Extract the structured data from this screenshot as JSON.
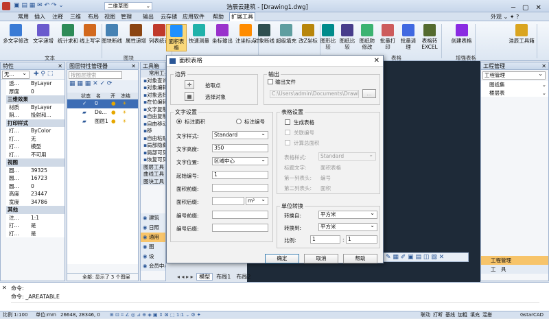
{
  "app": {
    "title": "浩辰云建筑 - [Drawing1.dwg]",
    "workspace": "二维草图",
    "appearance": "外观",
    "accent": "#2b5797"
  },
  "menu": [
    "常用",
    "插入",
    "注释",
    "三维",
    "布局",
    "视图",
    "管理",
    "输出",
    "云存储",
    "应用软件",
    "帮助",
    "扩展工具"
  ],
  "active_menu": "扩展工具",
  "ribbon": {
    "groups": [
      {
        "label": "文本",
        "buttons": [
          "多文字修改",
          "文字递增",
          "统计求和",
          "线上写字"
        ]
      },
      {
        "label": "图块",
        "buttons": [
          "图块断线",
          "属性递增",
          "列表统计"
        ]
      },
      {
        "label": "",
        "buttons": [
          "面积表格",
          "快速测量",
          "坐标输出",
          "注坐标点"
        ]
      },
      {
        "label": "",
        "buttons": [
          "对象断线",
          "超级填充",
          "改Z坐标"
        ]
      },
      {
        "label": "表格",
        "buttons": [
          "图形比较",
          "图纸比较",
          "图纸防修改",
          "批量打印",
          "批量清理",
          "表格转EXCEL"
        ]
      },
      {
        "label": "增强表格",
        "buttons": [
          "创建表格"
        ]
      },
      {
        "label": "",
        "buttons": [
          "浩辰工具箱"
        ]
      }
    ]
  },
  "properties": {
    "title": "特性",
    "selector": "无...",
    "rows": [
      {
        "type": "row",
        "k": "透...",
        "v": "ByLayer"
      },
      {
        "type": "row",
        "k": "厚度",
        "v": "0"
      },
      {
        "type": "cat",
        "k": "三维效果"
      },
      {
        "type": "row",
        "k": "材质",
        "v": "ByLayer"
      },
      {
        "type": "row",
        "k": "阴...",
        "v": "投射和..."
      },
      {
        "type": "cat",
        "k": "打印样式"
      },
      {
        "type": "row",
        "k": "打...",
        "v": "ByColor"
      },
      {
        "type": "row",
        "k": "打...",
        "v": "无"
      },
      {
        "type": "row",
        "k": "打...",
        "v": "模型"
      },
      {
        "type": "row",
        "k": "打...",
        "v": "不可用"
      },
      {
        "type": "cat",
        "k": "视图"
      },
      {
        "type": "row",
        "k": "圆...",
        "v": "39325"
      },
      {
        "type": "row",
        "k": "圆...",
        "v": "16723"
      },
      {
        "type": "row",
        "k": "圆...",
        "v": "0"
      },
      {
        "type": "row",
        "k": "高度",
        "v": "23447"
      },
      {
        "type": "row",
        "k": "宽度",
        "v": "34786"
      },
      {
        "type": "cat",
        "k": "其他"
      },
      {
        "type": "row",
        "k": "注...",
        "v": "1:1"
      },
      {
        "type": "row",
        "k": "打...",
        "v": "是"
      },
      {
        "type": "row",
        "k": "打...",
        "v": "是"
      }
    ]
  },
  "layers": {
    "title": "图层特性管理器",
    "search_placeholder": "按图层搜索",
    "headers": [
      "状态",
      "名",
      "开",
      "冻结"
    ],
    "items": [
      "0",
      "De...",
      "图层1"
    ],
    "footer": "全部: 显示了 3 个图层"
  },
  "tools": {
    "title": "工具箱",
    "items": [
      "常用工具",
      "对象查询",
      "对象编辑",
      "对象选择",
      "在位编辑",
      "文字复制",
      "自由复制",
      "自由移动",
      "移",
      "自由粘贴",
      "局部隐藏",
      "局部可见",
      "恢复可见",
      "图层工具",
      "曲线工具",
      "图块工具"
    ],
    "bottom": [
      "建筑",
      "日照",
      "通用",
      "图",
      "设",
      "会员中心"
    ]
  },
  "engineering": {
    "title": "工程管理",
    "combo": "工程管理",
    "items": [
      "图纸集",
      "楼层表"
    ],
    "tabs": [
      "工程管理",
      "工　具"
    ]
  },
  "dialog": {
    "title": "面积表格",
    "boundary": {
      "legend": "边界",
      "pick": "拾取点",
      "select": "选择对象"
    },
    "output": {
      "legend": "输出",
      "file_label": "输出文件",
      "path": "C:\\Users\\admin\\Documents\\Drawing1.",
      "browse": "..."
    },
    "text": {
      "legend": "文字设置",
      "radio_area": "标注面积",
      "radio_number": "标注编号",
      "style_label": "文字样式:",
      "style_value": "Standard",
      "height_label": "文字高度:",
      "height_value": "350",
      "position_label": "文字位置:",
      "position_value": "区域中心",
      "start_label": "起始编号:",
      "start_value": "1",
      "prefix_label": "面积前缀:",
      "prefix_value": "",
      "suffix_label": "面积后缀:",
      "suffix_value": "",
      "suffix_unit": "m²",
      "num_prefix_label": "编号前缀:",
      "num_prefix_value": "",
      "num_suffix_label": "编号后缀:",
      "num_suffix_value": ""
    },
    "table": {
      "legend": "表格设置",
      "gen": "生成表格",
      "link": "关联编号",
      "total": "计算总面积",
      "style_label": "表格样式:",
      "style_value": "Standard",
      "title_label": "标题文字:",
      "title_value": "面积表格",
      "col1_label": "第一列表头:",
      "col1_value": "编号",
      "col2_label": "第二列表头:",
      "col2_value": "面积"
    },
    "unit": {
      "legend": "单位转换",
      "from_label": "转换自:",
      "from_value": "平方米",
      "to_label": "转换到:",
      "to_value": "平方米",
      "ratio_label": "比例:",
      "ratio_a": "1",
      "ratio_colon": ":",
      "ratio_b": "1"
    },
    "buttons": {
      "ok": "确定",
      "cancel": "取消",
      "help": "帮助"
    }
  },
  "layout_tabs": [
    "模型",
    "布局1",
    "布局2"
  ],
  "command": {
    "line1": "命令:",
    "line2": "命令: _AREATABLE"
  },
  "status": {
    "scale": "比例 1:100",
    "units": "单位:mm",
    "coords": "26648, 28346, 0",
    "right": [
      "联动",
      "打断",
      "基线",
      "加粗",
      "填充",
      "混搭"
    ],
    "brand": "GstarCAD"
  }
}
